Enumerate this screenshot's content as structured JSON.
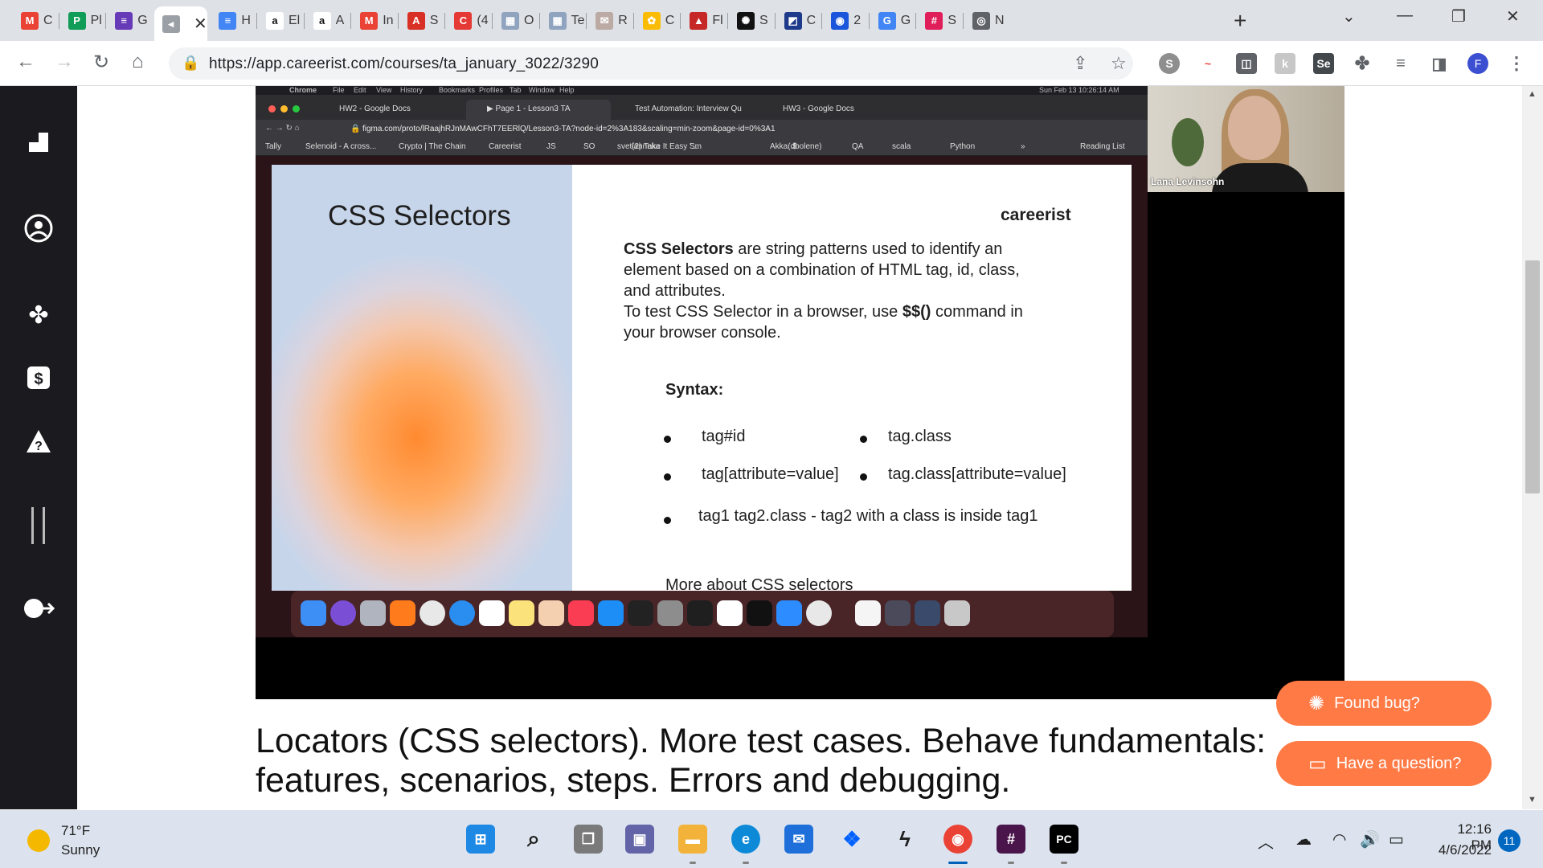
{
  "browser": {
    "tabs": [
      {
        "title": "C",
        "icon": "gmail-icon",
        "color": "#ea4335",
        "glyph": "M"
      },
      {
        "title": "Pl",
        "icon": "sheets-icon",
        "color": "#0f9d58",
        "glyph": "P"
      },
      {
        "title": "G",
        "icon": "forms-icon",
        "color": "#673ab7",
        "glyph": "≡"
      },
      {
        "title": "",
        "icon": "video-icon",
        "color": "#9aa0a6",
        "glyph": "◂"
      },
      {
        "title": "H",
        "icon": "docs-icon",
        "color": "#4285f4",
        "glyph": "≡"
      },
      {
        "title": "El",
        "icon": "amazon-icon",
        "color": "#ffffff",
        "glyph": "a"
      },
      {
        "title": "A",
        "icon": "amazon-icon",
        "color": "#ffffff",
        "glyph": "a"
      },
      {
        "title": "In",
        "icon": "gmail-icon",
        "color": "#ea4335",
        "glyph": "M"
      },
      {
        "title": "S",
        "icon": "pdf-icon",
        "color": "#d93025",
        "glyph": "A"
      },
      {
        "title": "(4",
        "icon": "c-icon",
        "color": "#e53935",
        "glyph": "C"
      },
      {
        "title": "O",
        "icon": "image-icon",
        "color": "#90a4c0",
        "glyph": "▦"
      },
      {
        "title": "Te",
        "icon": "image-icon",
        "color": "#90a4c0",
        "glyph": "▦"
      },
      {
        "title": "R",
        "icon": "mail-icon",
        "color": "#bcaaa4",
        "glyph": "✉"
      },
      {
        "title": "C",
        "icon": "puzzle-color-icon",
        "color": "#fbbc05",
        "glyph": "✿"
      },
      {
        "title": "Fl",
        "icon": "delta-icon",
        "color": "#c62828",
        "glyph": "▲"
      },
      {
        "title": "S",
        "icon": "sun-icon",
        "color": "#111111",
        "glyph": "✺"
      },
      {
        "title": "C",
        "icon": "stripe-icon",
        "color": "#1e3a8a",
        "glyph": "◩"
      },
      {
        "title": "2",
        "icon": "circle-icon",
        "color": "#1a56db",
        "glyph": "◉"
      },
      {
        "title": "G",
        "icon": "translate-icon",
        "color": "#4285f4",
        "glyph": "G"
      },
      {
        "title": "S",
        "icon": "slack-icon",
        "color": "#e01e5a",
        "glyph": "#"
      },
      {
        "title": "N",
        "icon": "globe-icon",
        "color": "#5f6368",
        "glyph": "◎"
      }
    ],
    "url": "https://app.careerist.com/courses/ta_january_3022/3290"
  },
  "inner": {
    "menubar": [
      "Chrome",
      "File",
      "Edit",
      "View",
      "History",
      "Bookmarks",
      "Profiles",
      "Tab",
      "Window",
      "Help"
    ],
    "menubar_right": "Sun Feb 13  10:26:14 AM",
    "tabs": [
      "HW2 - Google Docs",
      "▶ Page 1 - Lesson3 TA",
      "Test Automation: Interview Qu",
      "HW3 - Google Docs"
    ],
    "url": "figma.com/proto/lRaajhRJnMAwCFhT7EERlQ/Lesson3-TA?node-id=2%3A183&scaling=min-zoom&page-id=0%3A1",
    "bookmarks": [
      "Tally",
      "Selenoid - A cross...",
      "Crypto | The Chain",
      "Careerist",
      "JS",
      "SO",
      "svetlannnka",
      "(2) Take It Easy '...",
      "Sm",
      "Akka(dbolene)",
      "$",
      "QA",
      "scala",
      "Python",
      "»",
      "Reading List"
    ]
  },
  "slide": {
    "title": "CSS Selectors",
    "logo": "careerist",
    "desc_bold": "CSS Selectors",
    "desc_1": " are string patterns used to identify an",
    "desc_2": "element based on a combination of HTML tag, id, class,",
    "desc_3": "and attributes.",
    "desc_4a": "To test CSS Selector in a browser, use ",
    "desc_4b": "$$()",
    "desc_4c": " command in",
    "desc_5": "your browser console.",
    "syntax_label": "Syntax:",
    "syntax": [
      "tag#id",
      "tag.class",
      "tag[attribute=value]",
      "tag.class[attribute=value]",
      "tag1 tag2.class - tag2 with a class is inside tag1"
    ],
    "more": "More about CSS selectors"
  },
  "webcam": {
    "name": "Lana Levinsohn"
  },
  "lesson": {
    "title": "Locators (CSS selectors). More test cases. Behave fundamentals: features, scenarios, steps. Errors and debugging."
  },
  "buttons": {
    "bug": "Found bug?",
    "question": "Have a question?"
  },
  "taskbar": {
    "temp": "71°F",
    "weather": "Sunny",
    "time": "12:16 PM",
    "date": "4/6/2022",
    "notifications": "11"
  }
}
